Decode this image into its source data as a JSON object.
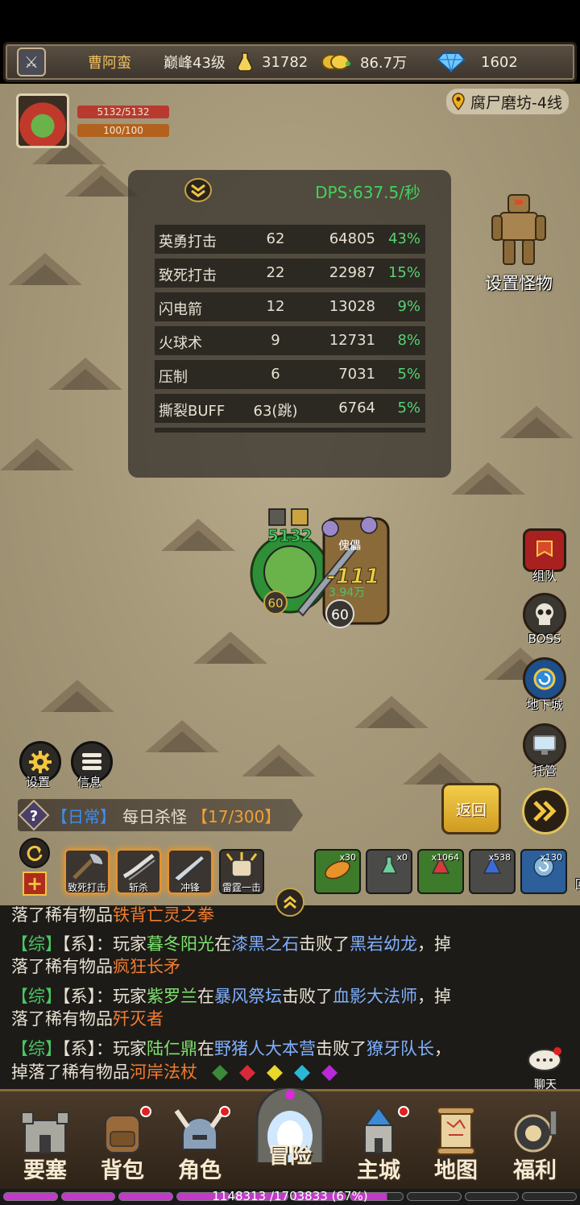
{
  "status": {
    "player_name": "曹阿蛮",
    "level": "巅峰43级",
    "power": "31782",
    "gold": "86.7万",
    "diamonds": "1602"
  },
  "player": {
    "hp": "5132/5132",
    "mp": "100/100"
  },
  "location": "腐尸磨坊-4线",
  "dps": {
    "title": "DPS:637.5/秒",
    "rows": [
      {
        "name": "英勇打击",
        "hits": "62",
        "damage": "64805",
        "pct": "43%"
      },
      {
        "name": "致死打击",
        "hits": "22",
        "damage": "22987",
        "pct": "15%"
      },
      {
        "name": "闪电箭",
        "hits": "12",
        "damage": "13028",
        "pct": "9%"
      },
      {
        "name": "火球术",
        "hits": "9",
        "damage": "12731",
        "pct": "8%"
      },
      {
        "name": "压制",
        "hits": "6",
        "damage": "7031",
        "pct": "5%"
      },
      {
        "name": "撕裂BUFF",
        "hits": "63(跳)",
        "damage": "6764",
        "pct": "5%"
      }
    ]
  },
  "set_monster_label": "设置怪物",
  "side_buttons": [
    "组队",
    "BOSS",
    "地下城",
    "托管"
  ],
  "battle": {
    "player_hp_text": "5132",
    "damage_text": "-111",
    "enemy_name": "傀儡",
    "enemy_hp_text": "3.94万",
    "player_level": "60",
    "enemy_level": "60"
  },
  "settings_label": "设置",
  "info_label": "信息",
  "quest": {
    "tag": "【日常】",
    "name": "每日杀怪",
    "progress": "【17/300】"
  },
  "back_label": "返回",
  "skills": [
    "致死打击",
    "斩杀",
    "冲锋",
    "雷霆一击"
  ],
  "items": [
    {
      "label": "食物",
      "count": "x30"
    },
    {
      "label": "饮料",
      "count": "x0"
    },
    {
      "label": "红药",
      "count": "x1064"
    },
    {
      "label": "蓝药",
      "count": "x538"
    },
    {
      "label": "回城",
      "count": "x130"
    }
  ],
  "chat": {
    "line0": {
      "a": "落了稀有物品",
      "b": "铁背亡灵之拳"
    },
    "line1": {
      "tag1": "【综】",
      "tag2": "【系】",
      "p1": "：玩家",
      "player": "暮冬阳光",
      "p2": "在",
      "place": "漆黑之石",
      "p3": "击败了",
      "boss": "黑岩幼龙",
      "p4": "，掉"
    },
    "line2": {
      "a": "落了稀有物品",
      "b": "疯狂长矛"
    },
    "line3": {
      "tag1": "【综】",
      "tag2": "【系】",
      "p1": "：玩家",
      "player": "紫罗兰",
      "p2": "在",
      "place": "暴风祭坛",
      "p3": "击败了",
      "boss": "血影大法师",
      "p4": "，掉"
    },
    "line4": {
      "a": "落了稀有物品",
      "b": "歼灭者"
    },
    "line5": {
      "tag1": "【综】",
      "tag2": "【系】",
      "p1": "：玩家",
      "player": "陆仁鼎",
      "p2": "在",
      "place": "野猪人大本营",
      "p3": "击败了",
      "boss": "獠牙队长",
      "p4": "，"
    },
    "line6": {
      "a": "掉落了稀有物品",
      "b": "河岸法杖"
    },
    "bubble_label": "聊天"
  },
  "nav": [
    "要塞",
    "背包",
    "角色",
    "冒险",
    "主城",
    "地图",
    "福利"
  ],
  "exp_text": "1148313 /1703833 (67%)",
  "exp_fraction": 0.67,
  "colors": {
    "accent_gold": "#f2cd4a",
    "dps_green": "#41d35a",
    "hp_red": "#b83a2e",
    "mp_orange": "#b2621e"
  }
}
